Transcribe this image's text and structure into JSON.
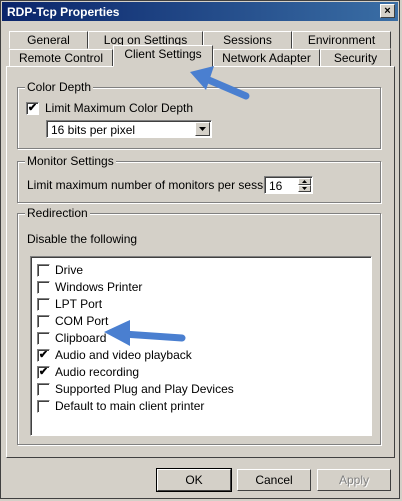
{
  "window": {
    "title": "RDP-Tcp Properties",
    "close_glyph": "×"
  },
  "tabs_row1": [
    {
      "label": "General"
    },
    {
      "label": "Log on Settings"
    },
    {
      "label": "Sessions"
    },
    {
      "label": "Environment"
    }
  ],
  "tabs_row2": [
    {
      "label": "Remote Control"
    },
    {
      "label": "Client Settings"
    },
    {
      "label": "Network Adapter"
    },
    {
      "label": "Security"
    }
  ],
  "active_tab": "Client Settings",
  "color_depth": {
    "group_title": "Color Depth",
    "limit_label": "Limit Maximum Color Depth",
    "limit_checked": true,
    "selected_value": "16 bits per pixel"
  },
  "monitor_settings": {
    "group_title": "Monitor Settings",
    "label": "Limit maximum number of monitors per session",
    "value": "16"
  },
  "redirection": {
    "group_title": "Redirection",
    "subtitle": "Disable the following",
    "items": [
      {
        "label": "Drive",
        "checked": false
      },
      {
        "label": "Windows Printer",
        "checked": false
      },
      {
        "label": "LPT Port",
        "checked": false
      },
      {
        "label": "COM Port",
        "checked": false
      },
      {
        "label": "Clipboard",
        "checked": false
      },
      {
        "label": "Audio and video playback",
        "checked": true
      },
      {
        "label": "Audio recording",
        "checked": true
      },
      {
        "label": "Supported Plug and Play Devices",
        "checked": false
      },
      {
        "label": "Default to main client printer",
        "checked": false
      }
    ]
  },
  "buttons": {
    "ok": "OK",
    "cancel": "Cancel",
    "apply": "Apply"
  },
  "annotation_color": "#4a7fd0"
}
